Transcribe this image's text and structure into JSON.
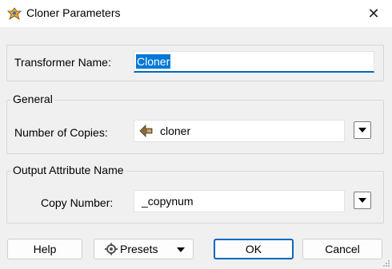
{
  "window": {
    "title": "Cloner Parameters",
    "close_glyph": "✕",
    "app_icon": "transformer-icon"
  },
  "transformer": {
    "label": "Transformer Name:",
    "value": "Cloner"
  },
  "general": {
    "group_title": "General",
    "copies_label": "Number of Copies:",
    "copies_value": "cloner",
    "copies_icon": "attribute-value-icon"
  },
  "output": {
    "group_title": "Output Attribute Name",
    "copy_number_label": "Copy Number:",
    "copy_number_value": "_copynum"
  },
  "buttons": {
    "help": "Help",
    "presets": "Presets",
    "presets_icon": "gear-icon",
    "ok": "OK",
    "cancel": "Cancel"
  },
  "colors": {
    "accent": "#0067c0",
    "selection": "#0078d7",
    "attribute_icon": "#8a6a3b"
  }
}
